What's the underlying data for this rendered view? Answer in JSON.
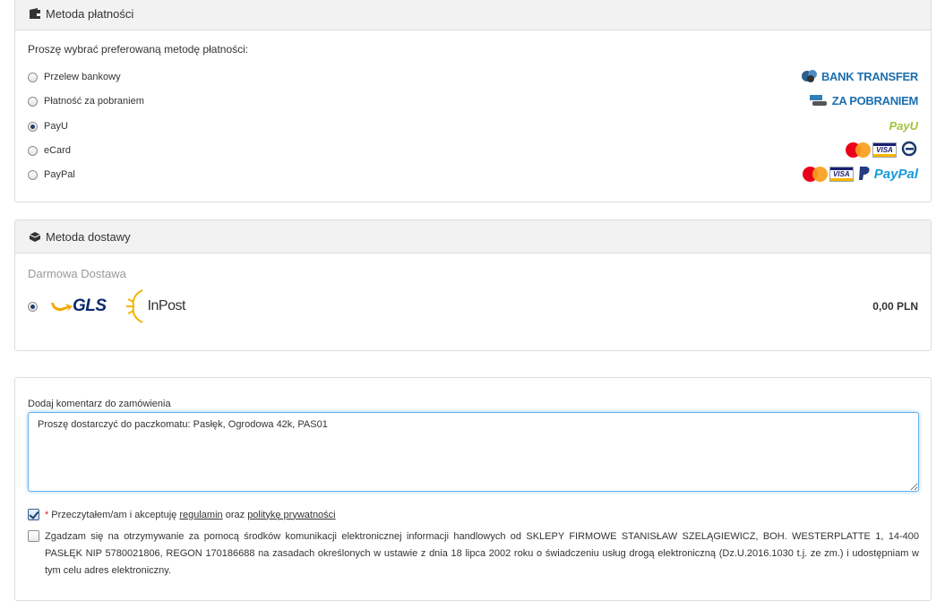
{
  "payment": {
    "title": "Metoda płatności",
    "intro": "Proszę wybrać preferowaną metodę płatności:",
    "options": [
      {
        "label": "Przelew bankowy",
        "logo_text": "BANK TRANSFER",
        "selected": false
      },
      {
        "label": "Płatność za pobraniem",
        "logo_text": "ZA POBRANIEM",
        "selected": false
      },
      {
        "label": "PayU",
        "logo_text": "PayU",
        "selected": true
      },
      {
        "label": "eCard",
        "logo_text": "",
        "selected": false
      },
      {
        "label": "PayPal",
        "logo_text": "PayPal",
        "selected": false
      }
    ]
  },
  "shipping": {
    "title": "Metoda dostawy",
    "name": "Darmowa Dostawa",
    "carriers": [
      "GLS",
      "InPost"
    ],
    "price": "0,00 PLN",
    "selected": true
  },
  "comment": {
    "label": "Dodaj komentarz do zamówienia",
    "value": "Proszę dostarczyć do paczkomatu: Pasłęk, Ogrodowa 42k, PAS01"
  },
  "terms": {
    "required_mark": "*",
    "text_before": "Przeczytałem/am i akceptuję",
    "link_regulamin": "regulamin",
    "text_and": "oraz",
    "link_privacy": "politykę prywatności",
    "checked": true
  },
  "consent": {
    "text": "Zgadzam się na otrzymywanie za pomocą środków komunikacji elektronicznej informacji handlowych od SKLEPY FIRMOWE STANISŁAW SZELĄGIEWICZ, BOH. WESTERPLATTE 1, 14-400 PASŁĘK NIP 5780021806, REGON 170186688 na zasadach określonych w ustawie z dnia 18 lipca 2002 roku o świadczeniu usług drogą elektroniczną (Dz.U.2016.1030 t.j. ze zm.) i udostępniam w tym celu adres elektroniczny.",
    "checked": false
  },
  "colors": {
    "accent": "#1c6fae",
    "panel_header": "#f2f2f2",
    "border": "#dcdcdc",
    "required": "#e02020"
  },
  "icons": {
    "payment_header": "wallet-icon",
    "shipping_header": "truck-icon"
  }
}
